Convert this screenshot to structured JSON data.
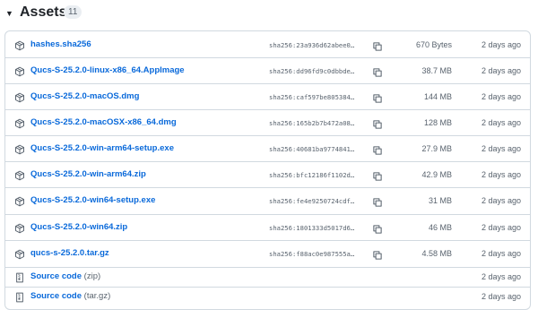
{
  "assets": {
    "title": "Assets",
    "count": "11",
    "files": [
      {
        "name": "hashes.sha256",
        "sha": "sha256:23a936d62abee0…",
        "size": "670 Bytes",
        "date": "2 days ago",
        "icon": "package-icon"
      },
      {
        "name": "Qucs-S-25.2.0-linux-x86_64.AppImage",
        "sha": "sha256:dd96fd9c0dbbde…",
        "size": "38.7 MB",
        "date": "2 days ago",
        "icon": "package-icon"
      },
      {
        "name": "Qucs-S-25.2.0-macOS.dmg",
        "sha": "sha256:caf597be805384…",
        "size": "144 MB",
        "date": "2 days ago",
        "icon": "package-icon"
      },
      {
        "name": "Qucs-S-25.2.0-macOSX-x86_64.dmg",
        "sha": "sha256:165b2b7b472a08…",
        "size": "128 MB",
        "date": "2 days ago",
        "icon": "package-icon"
      },
      {
        "name": "Qucs-S-25.2.0-win-arm64-setup.exe",
        "sha": "sha256:40681ba9774841…",
        "size": "27.9 MB",
        "date": "2 days ago",
        "icon": "package-icon"
      },
      {
        "name": "Qucs-S-25.2.0-win-arm64.zip",
        "sha": "sha256:bfc12186f1102d…",
        "size": "42.9 MB",
        "date": "2 days ago",
        "icon": "package-icon"
      },
      {
        "name": "Qucs-S-25.2.0-win64-setup.exe",
        "sha": "sha256:fe4e9250724cdf…",
        "size": "31 MB",
        "date": "2 days ago",
        "icon": "package-icon"
      },
      {
        "name": "Qucs-S-25.2.0-win64.zip",
        "sha": "sha256:1801333d5017d6…",
        "size": "46 MB",
        "date": "2 days ago",
        "icon": "package-icon"
      },
      {
        "name": "qucs-s-25.2.0.tar.gz",
        "sha": "sha256:f88ac0e987555a…",
        "size": "4.58 MB",
        "date": "2 days ago",
        "icon": "package-icon"
      }
    ],
    "source": [
      {
        "label": "Source code",
        "format": "(zip)",
        "date": "2 days ago",
        "icon": "file-zip-icon"
      },
      {
        "label": "Source code",
        "format": "(tar.gz)",
        "date": "2 days ago",
        "icon": "file-zip-icon"
      }
    ],
    "colors": {
      "link": "#0969da",
      "muted": "#59636e",
      "border": "#d1d9e0",
      "counter_bg": "#eaeef2"
    }
  }
}
